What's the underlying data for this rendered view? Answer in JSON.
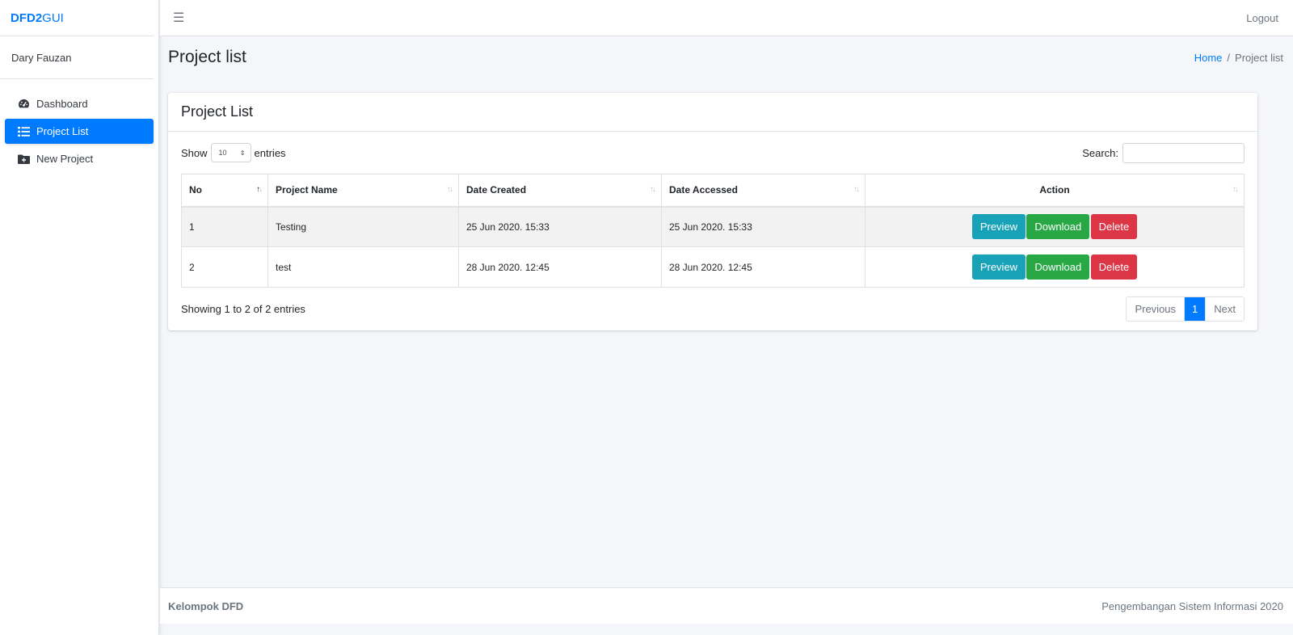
{
  "brand": {
    "part1": "DFD2",
    "part2": "GUI"
  },
  "user": {
    "name": "Dary Fauzan"
  },
  "sidebar": {
    "items": [
      {
        "label": "Dashboard",
        "icon": "tachometer-icon",
        "active": false
      },
      {
        "label": "Project List",
        "icon": "list-icon",
        "active": true
      },
      {
        "label": "New Project",
        "icon": "folder-plus-icon",
        "active": false
      }
    ]
  },
  "topbar": {
    "menu_icon": "hamburger-icon",
    "logout_label": "Logout"
  },
  "header": {
    "title": "Project list",
    "breadcrumb": {
      "home": "Home",
      "separator": "/",
      "current": "Project list"
    }
  },
  "card": {
    "title": "Project List",
    "length": {
      "show": "Show",
      "value": "10",
      "entries": "entries"
    },
    "search_label": "Search:",
    "table": {
      "columns": [
        "No",
        "Project Name",
        "Date Created",
        "Date Accessed",
        "Action"
      ],
      "rows": [
        {
          "no": "1",
          "name": "Testing",
          "created": "25 Jun 2020. 15:33",
          "accessed": "25 Jun 2020. 15:33"
        },
        {
          "no": "2",
          "name": "test",
          "created": "28 Jun 2020. 12:45",
          "accessed": "28 Jun 2020. 12:45"
        }
      ],
      "action_labels": {
        "preview": "Preview",
        "download": "Download",
        "delete": "Delete"
      }
    },
    "info": "Showing 1 to 2 of 2 entries",
    "pagination": {
      "previous": "Previous",
      "current": "1",
      "next": "Next"
    }
  },
  "footer": {
    "left": "Kelompok DFD",
    "right": "Pengembangan Sistem Informasi 2020"
  },
  "colors": {
    "primary": "#007bff",
    "info": "#17a2b8",
    "success": "#28a745",
    "danger": "#dc3545"
  }
}
